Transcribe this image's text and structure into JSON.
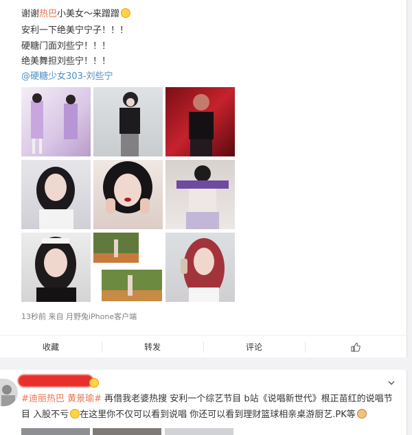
{
  "post1": {
    "line1": {
      "prefix": "谢谢",
      "highlight": "热巴",
      "suffix": "小美女～来蹭蹭"
    },
    "line2": "安利一下绝美宁宁子！！！",
    "line3": "硬糖门面刘些宁！！！",
    "line4": "绝美舞担刘些宁！！！",
    "mention": "@硬糖少女303-刘些宁",
    "meta": "13秒前  来自 月野兔iPhone客户端",
    "actions": {
      "collect": "收藏",
      "repost": "转发",
      "comment": "评论"
    },
    "images": [
      "photo-1",
      "photo-2",
      "photo-3",
      "photo-4",
      "photo-5",
      "photo-6",
      "photo-7",
      "photo-8",
      "photo-9"
    ]
  },
  "post2": {
    "topic1": "#迪丽热巴",
    "topic2": "黄景瑜#",
    "text1": "再借我老婆热搜 安利一个综艺节目 b站《说唱新世代》根正苗红的说唱节",
    "text2a": "目 入股不亏",
    "text2b": "在这里你不仅可以看到说唱 你还可以看到理财篮球相亲桌游厨艺.PK等"
  },
  "icons": {
    "like": "thumbs-up-icon",
    "expand": "chevron-down-icon",
    "emoji": "emoji-icon"
  }
}
